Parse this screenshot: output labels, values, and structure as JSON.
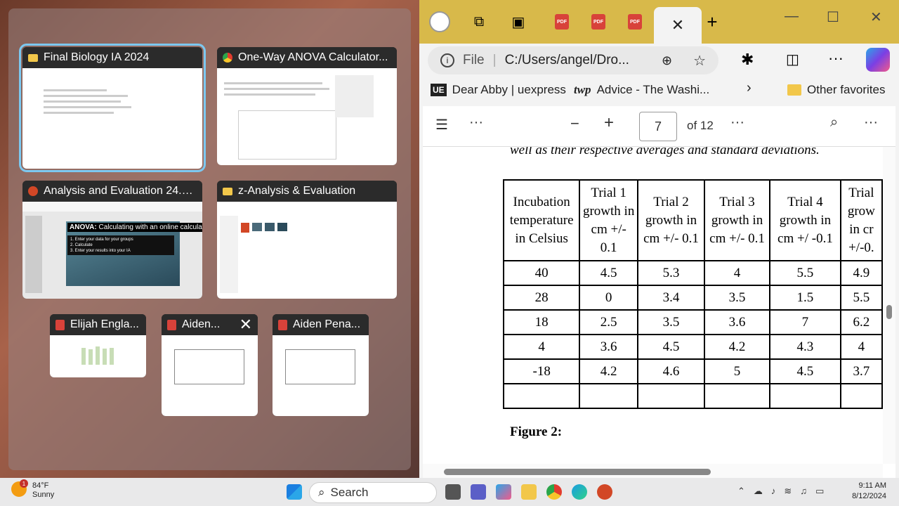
{
  "taskview": {
    "windows": [
      {
        "title": "Final Biology IA 2024",
        "icon": "folder-icon"
      },
      {
        "title": "One-Way ANOVA Calculator...",
        "icon": "chrome-icon"
      },
      {
        "title": "Analysis and Evaluation 24.p...",
        "icon": "powerpoint-icon",
        "slide_heading": "ANOVA:",
        "slide_sub": "Calculating with an online calculator",
        "slide_items": [
          "1. Enter your data for your groups",
          "2. Calculate",
          "3. Enter your results into your IA"
        ]
      },
      {
        "title": "z-Analysis & Evaluation",
        "icon": "folder-icon"
      },
      {
        "title": "Elijah Engla...",
        "icon": "pdf-icon"
      },
      {
        "title": "Aiden...",
        "icon": "pdf-icon"
      },
      {
        "title": "Aiden Pena...",
        "icon": "pdf-icon"
      }
    ]
  },
  "browser": {
    "address": {
      "prefix": "File",
      "path": "C:/Users/angel/Dro..."
    },
    "bookmarks": [
      {
        "label": "Dear Abby | uexpress",
        "icon": "UE"
      },
      {
        "label": "Advice - The Washi...",
        "icon": "twp"
      }
    ],
    "other_favorites": "Other favorites",
    "pdf": {
      "page": "7",
      "of": "of 12"
    },
    "tab_pdf_label": "PDF"
  },
  "document": {
    "caption": "well as their respective averages and standard deviations.",
    "headers": [
      "Incubation temperature in Celsius",
      "Trial 1 growth in cm +/- 0.1",
      "Trial 2 growth in cm +/- 0.1",
      "Trial 3 growth in cm +/- 0.1",
      "Trial 4 growth in cm +/ -0.1",
      "Trial grow in cr +/-0."
    ],
    "rows": [
      [
        "40",
        "4.5",
        "5.3",
        "4",
        "5.5",
        "4.9"
      ],
      [
        "28",
        "0",
        "3.4",
        "3.5",
        "1.5",
        "5.5"
      ],
      [
        "18",
        "2.5",
        "3.5",
        "3.6",
        "7",
        "6.2"
      ],
      [
        "4",
        "3.6",
        "4.5",
        "4.2",
        "4.3",
        "4"
      ],
      [
        "-18",
        "4.2",
        "4.6",
        "5",
        "4.5",
        "3.7"
      ],
      [
        "",
        "",
        "",
        "",
        "",
        ""
      ]
    ],
    "figure": "Figure 2:"
  },
  "taskbar": {
    "weather_temp": "84°F",
    "weather_desc": "Sunny",
    "weather_badge": "1",
    "search": "Search",
    "time": "9:11 AM",
    "date": "8/12/2024"
  }
}
